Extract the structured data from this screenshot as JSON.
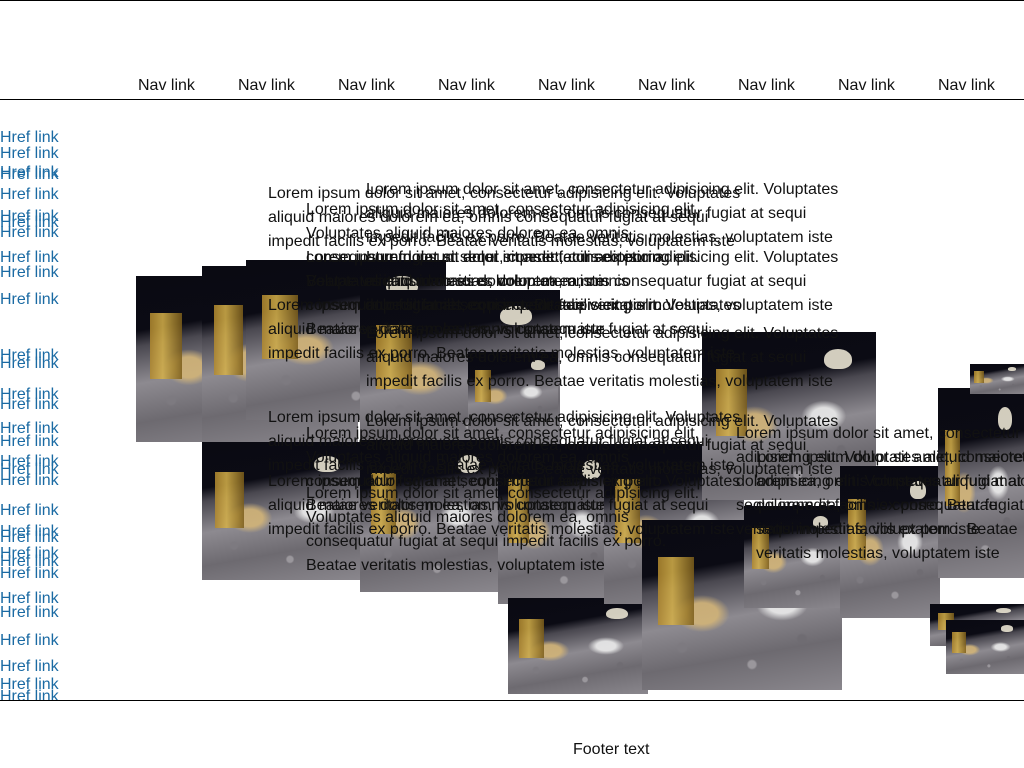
{
  "header": {
    "nav": [
      {
        "label": "Nav link"
      },
      {
        "label": "Nav link"
      },
      {
        "label": "Nav link"
      },
      {
        "label": "Nav link"
      },
      {
        "label": "Nav link"
      },
      {
        "label": "Nav link"
      },
      {
        "label": "Nav link"
      },
      {
        "label": "Nav link"
      },
      {
        "label": "Nav link"
      }
    ]
  },
  "sidebar": {
    "link_label": "Href link",
    "link_color": "#1a6aa3"
  },
  "content": {
    "paragraph": "Lorem ipsum dolor sit amet, consectetur adipisicing elit. Voluptates aliquid maiores dolorem ea, omnis consequatur fugiat at sequi impedit facilis ex porro. Beatae veritatis molestias, voluptatem iste",
    "image_subject": "lunar-rover-photo"
  },
  "footer": {
    "text": "Footer text"
  }
}
